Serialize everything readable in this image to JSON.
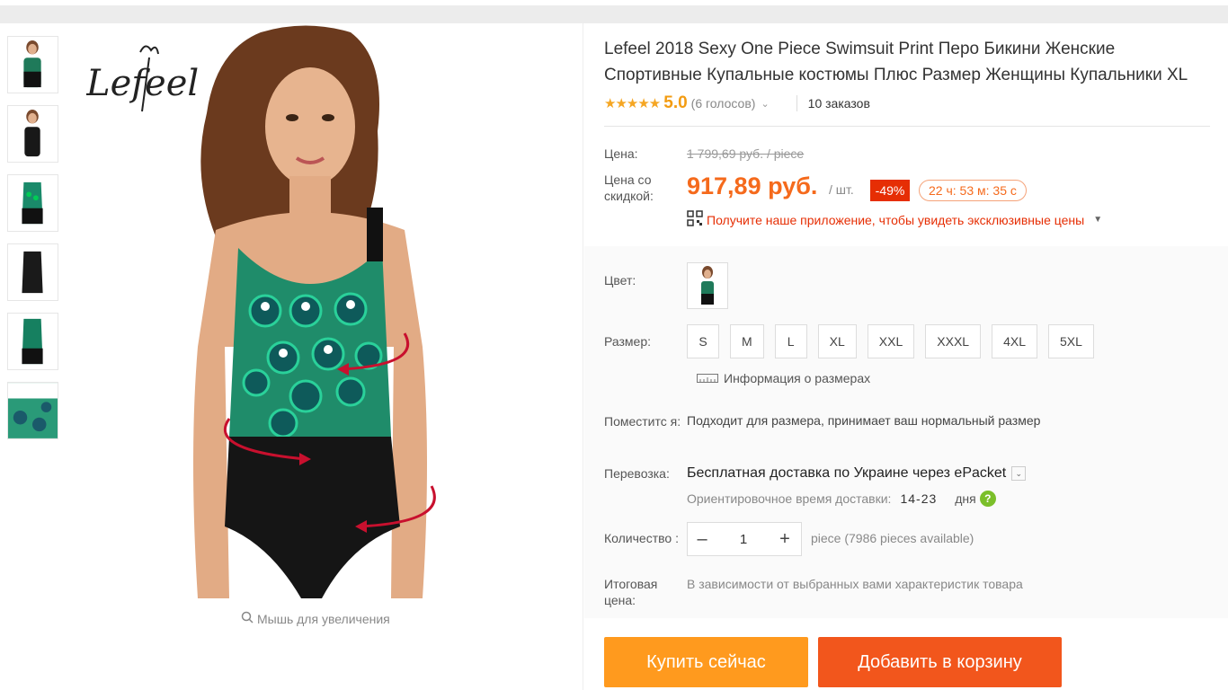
{
  "product": {
    "title": "Lefeel 2018 Sexy One Piece Swimsuit Print Перо Бикини Женские Спортивные Купальные костюмы Плюс Размер Женщины Купальники XL",
    "brand_logo_text": "Lefeel"
  },
  "rating": {
    "stars": "★★★★★",
    "score": "5.0",
    "votes": "(6 голосов)",
    "orders": "10 заказов"
  },
  "price": {
    "label": "Цена:",
    "old": "1 799,69 руб. / piece",
    "discount_label": "Цена со скидкой:",
    "new": "917,89 руб.",
    "per_unit": "/ шт.",
    "discount_badge": "-49%",
    "timer": "22 ч: 53 м: 35 с",
    "app_promo": "Получите наше приложение, чтобы увидеть эксклюзивные цены"
  },
  "options": {
    "color_label": "Цвет:",
    "size_label": "Размер:",
    "sizes": [
      "S",
      "M",
      "L",
      "XL",
      "XXL",
      "XXXL",
      "4XL",
      "5XL"
    ],
    "size_info": "Информация о размерах",
    "fit_label": "Поместитс я:",
    "fit_text": "Подходит для размера, принимает ваш нормальный размер",
    "shipping_label": "Перевозка:",
    "shipping_main": "Бесплатная доставка по Украине через ePacket",
    "shipping_time_label": "Ориентировочное время доставки:",
    "shipping_days": "14-23",
    "shipping_days_unit": "дня",
    "qty_label": "Количество :",
    "qty_value": "1",
    "qty_minus": "–",
    "qty_plus": "+",
    "availability": "piece (7986 pieces available)",
    "total_label": "Итоговая цена:",
    "total_note": "В зависимости от выбранных вами характеристик товара"
  },
  "gallery": {
    "zoom_hint": "Мышь для увеличения"
  },
  "actions": {
    "buy_now": "Купить сейчас",
    "add_to_cart": "Добавить в корзину"
  },
  "colors": {
    "accent_orange": "#f56a1c",
    "buy_button": "#ff9a1e",
    "cart_button": "#f2561c",
    "discount_red": "#e62e04",
    "star": "#f5a623"
  }
}
